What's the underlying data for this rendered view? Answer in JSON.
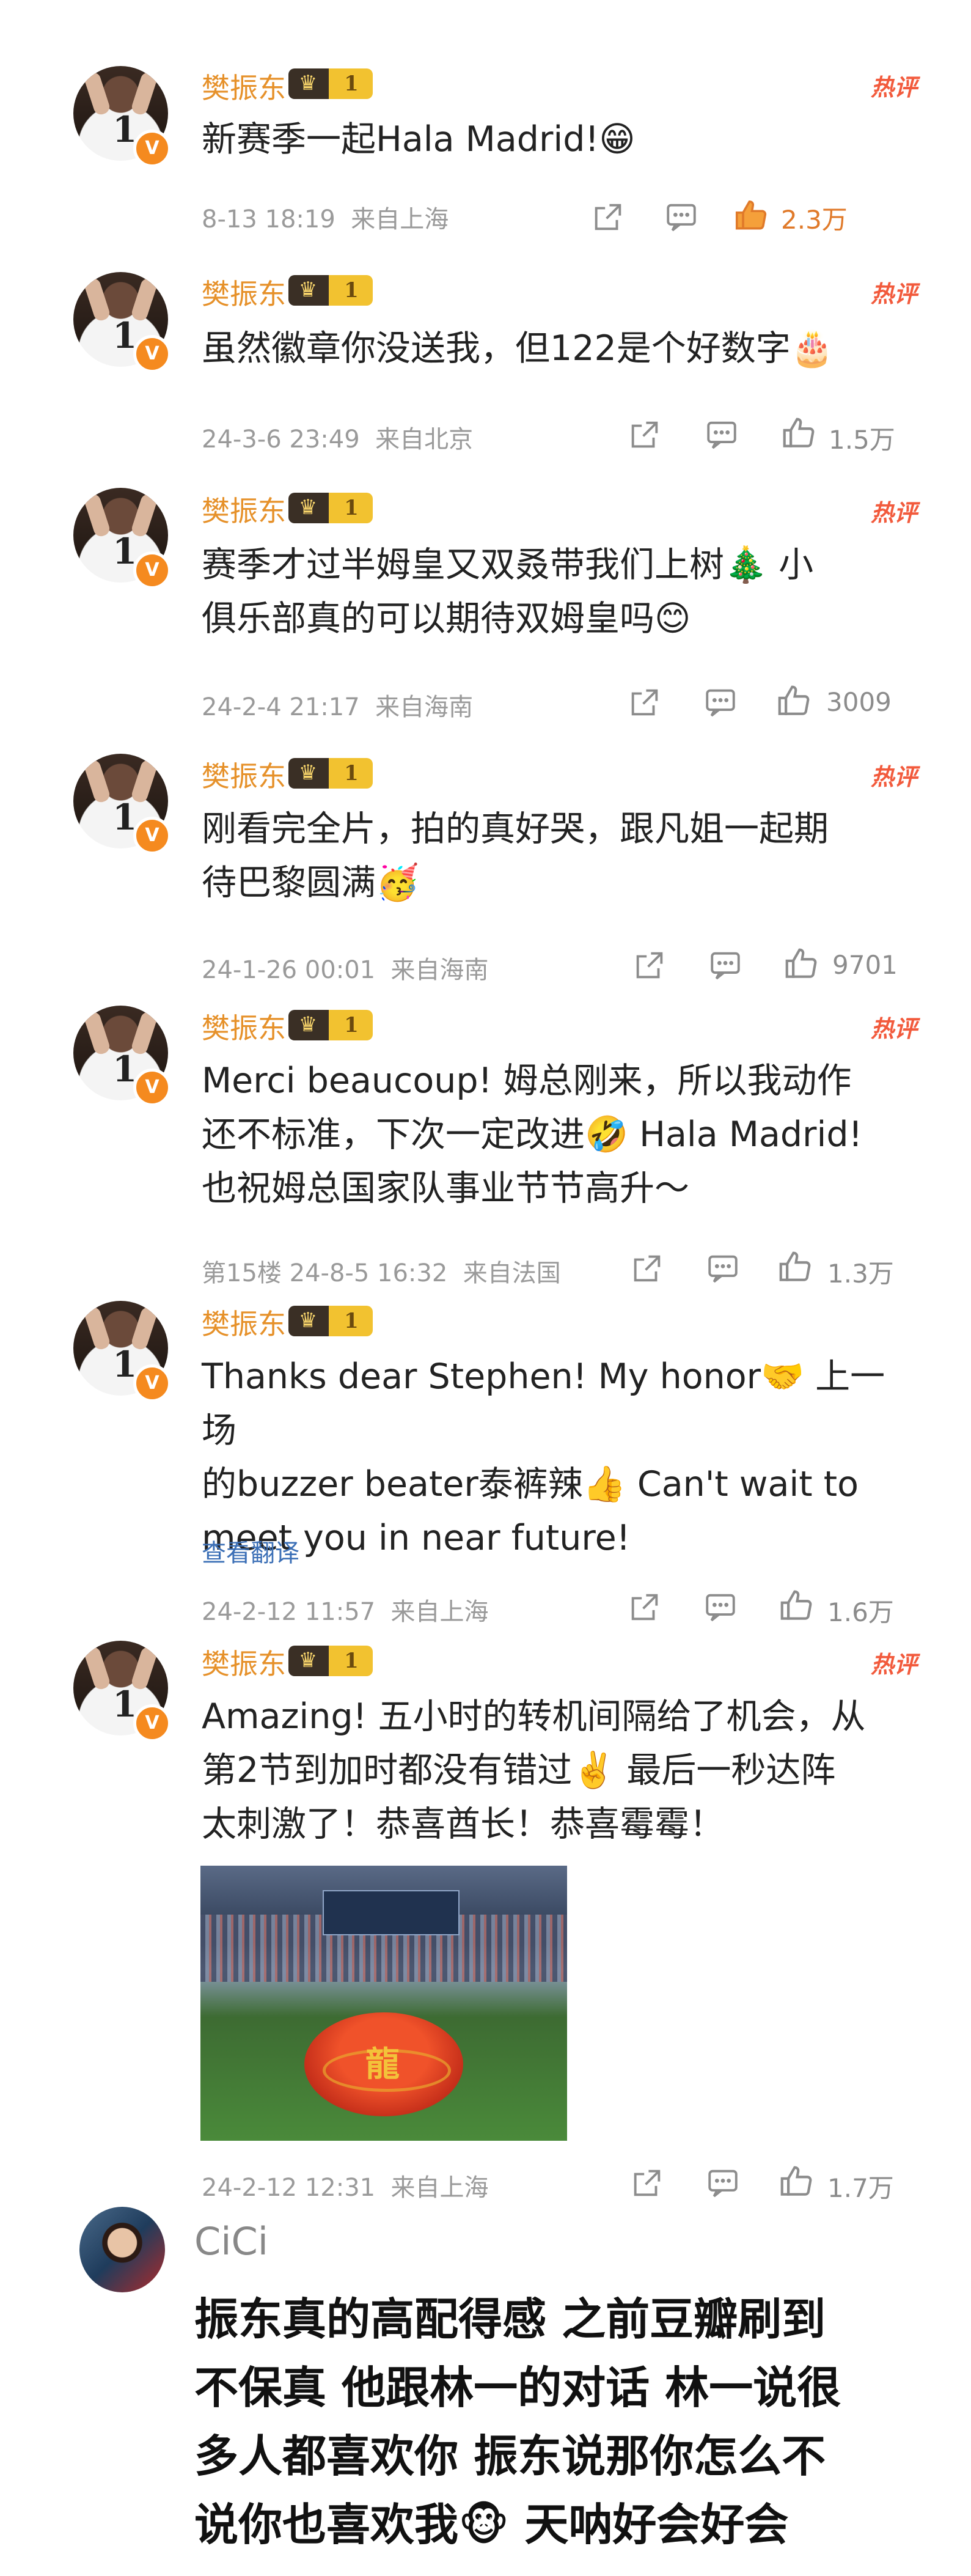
{
  "comments": [
    {
      "user": "樊振东",
      "vip_level": "1",
      "hot_label": "热评",
      "text_lines": [
        "新赛季一起Hala Madrid!😁"
      ],
      "time": "8-13 18:19",
      "location": "来自上海",
      "floor": "",
      "likes": "2.3万",
      "liked": true,
      "translate": ""
    },
    {
      "user": "樊振东",
      "vip_level": "1",
      "hot_label": "热评",
      "text_lines": [
        "虽然徽章你没送我，但122是个好数字🎂"
      ],
      "time": "24-3-6 23:49",
      "location": "来自北京",
      "floor": "",
      "likes": "1.5万",
      "liked": false,
      "translate": ""
    },
    {
      "user": "樊振东",
      "vip_level": "1",
      "hot_label": "热评",
      "text_lines": [
        "赛季才过半姆皇又双叒带我们上树🎄 小",
        "俱乐部真的可以期待双姆皇吗😊"
      ],
      "time": "24-2-4 21:17",
      "location": "来自海南",
      "floor": "",
      "likes": "3009",
      "liked": false,
      "translate": ""
    },
    {
      "user": "樊振东",
      "vip_level": "1",
      "hot_label": "热评",
      "text_lines": [
        "刚看完全片，拍的真好哭，跟凡姐一起期",
        "待巴黎圆满🥳"
      ],
      "time": "24-1-26 00:01",
      "location": "来自海南",
      "floor": "",
      "likes": "9701",
      "liked": false,
      "translate": ""
    },
    {
      "user": "樊振东",
      "vip_level": "1",
      "hot_label": "热评",
      "text_lines": [
        "Merci beaucoup! 姆总刚来，所以我动作",
        "还不标准，下次一定改进🤣 Hala Madrid!",
        "也祝姆总国家队事业节节高升～"
      ],
      "time": "24-8-5 16:32",
      "location": "来自法国",
      "floor": "第15楼",
      "likes": "1.3万",
      "liked": false,
      "translate": ""
    },
    {
      "user": "樊振东",
      "vip_level": "1",
      "hot_label": "",
      "text_lines": [
        "Thanks dear Stephen! My honor🤝 上一场",
        "的buzzer beater泰裤辣👍 Can't wait to",
        "meet you in near future!"
      ],
      "time": "24-2-12 11:57",
      "location": "来自上海",
      "floor": "",
      "likes": "1.6万",
      "liked": false,
      "translate": "查看翻译"
    },
    {
      "user": "樊振东",
      "vip_level": "1",
      "hot_label": "热评",
      "text_lines": [
        "Amazing! 五小时的转机间隔给了机会，从",
        "第2节到加时都没有错过✌️ 最后一秒达阵",
        "太刺激了！恭喜酋长！恭喜霉霉！"
      ],
      "time": "24-2-12 12:31",
      "location": "来自上海",
      "floor": "",
      "likes": "1.7万",
      "liked": false,
      "translate": "",
      "photo_text": "龍"
    }
  ],
  "cici": {
    "name": "CiCi",
    "text_lines": [
      "振东真的高配得感 之前豆瓣刷到",
      "不保真 他跟林一的对话 林一说很",
      "多人都喜欢你 振东说那你怎么不",
      "说你也喜欢我🐵 天呐好会好会"
    ]
  },
  "colors": {
    "username": "#e6912a",
    "hot": "#f25a3c",
    "meta": "#9a9a9a",
    "liked": "#e07a2a",
    "link": "#3b6fb6"
  },
  "icons": [
    "share-icon",
    "comment-icon",
    "like-icon",
    "v-verified-icon",
    "crown-icon"
  ]
}
